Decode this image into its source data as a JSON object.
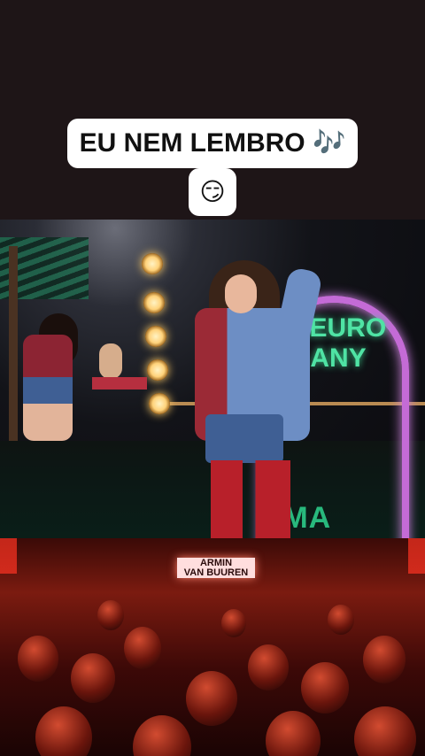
{
  "caption": {
    "line1": "EU NEM LEMBRO 🎶",
    "line2": "😏"
  },
  "video": {
    "arch_sign": "NEURO\nANY",
    "floor_sign": "MMA"
  },
  "crowd_screen": {
    "text": "ARMIN\nVAN BUUREN"
  },
  "colors": {
    "caption_bg": "#ffffff",
    "neon_green": "#4fe3a4",
    "neon_pink": "#c46bd6",
    "crowd_red": "#7b1b10"
  }
}
